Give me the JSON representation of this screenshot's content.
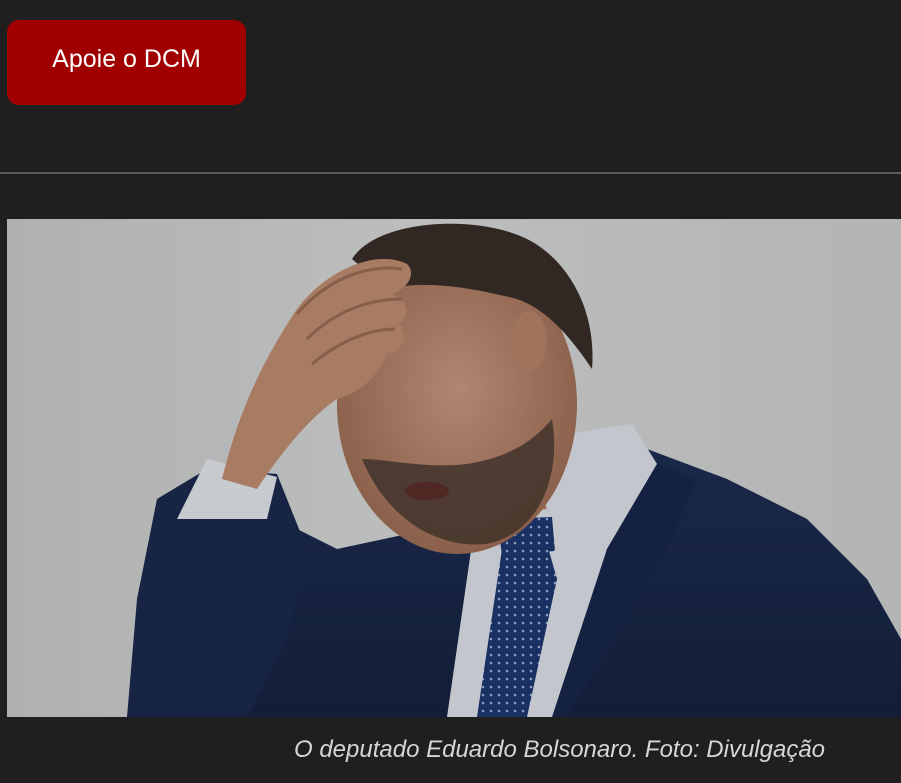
{
  "header": {
    "support_button_label": "Apoie o DCM",
    "accent_color": "#a00000"
  },
  "article": {
    "photo_alt": "O deputado Eduardo Bolsonaro",
    "caption": "O deputado Eduardo Bolsonaro. Foto: Divulgação"
  }
}
